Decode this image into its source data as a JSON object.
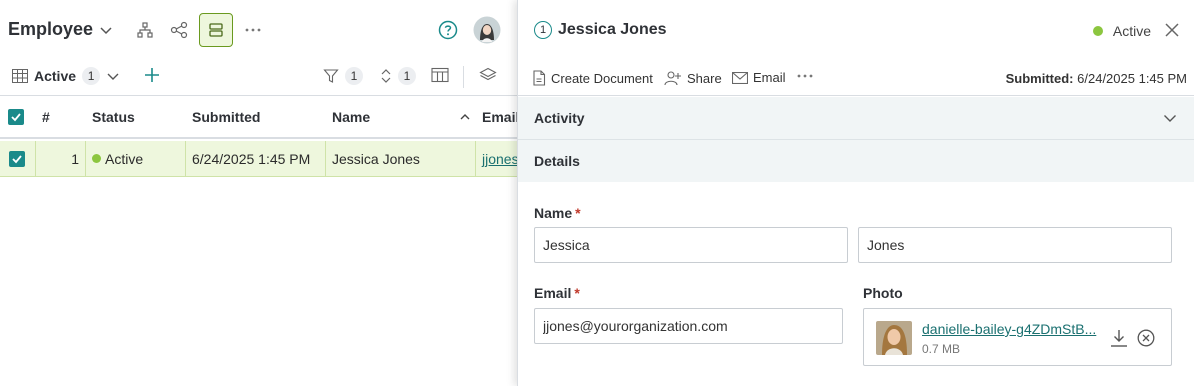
{
  "app": {
    "title": "Employee"
  },
  "view": {
    "name": "Active",
    "count": "1",
    "filter_count": "1",
    "sort_count": "1"
  },
  "grid": {
    "headers": {
      "num": "#",
      "status": "Status",
      "submitted": "Submitted",
      "name": "Name",
      "email": "Email"
    },
    "rows": [
      {
        "num": "1",
        "status": "Active",
        "submitted": "6/24/2025 1:45 PM",
        "name": "Jessica Jones",
        "email": "jjones"
      }
    ]
  },
  "panel": {
    "record_number": "1",
    "title": "Jessica Jones",
    "status": "Active",
    "actions": {
      "create_document": "Create Document",
      "share": "Share",
      "email": "Email"
    },
    "submitted_label": "Submitted:",
    "submitted_value": "6/24/2025 1:45 PM",
    "sections": {
      "activity": "Activity",
      "details": "Details"
    },
    "fields": {
      "name_label": "Name",
      "first_name": "Jessica",
      "last_name": "Jones",
      "email_label": "Email",
      "email_value": "jjones@yourorganization.com",
      "photo_label": "Photo",
      "photo_filename": "danielle-bailey-g4ZDmStB...",
      "photo_size": "0.7 MB"
    },
    "required_marker": "*"
  },
  "colors": {
    "accent": "#1a8a8a",
    "active_dot": "#8cc63f",
    "selected_row": "#eef7dd",
    "section_bg": "#f1f5f6"
  }
}
